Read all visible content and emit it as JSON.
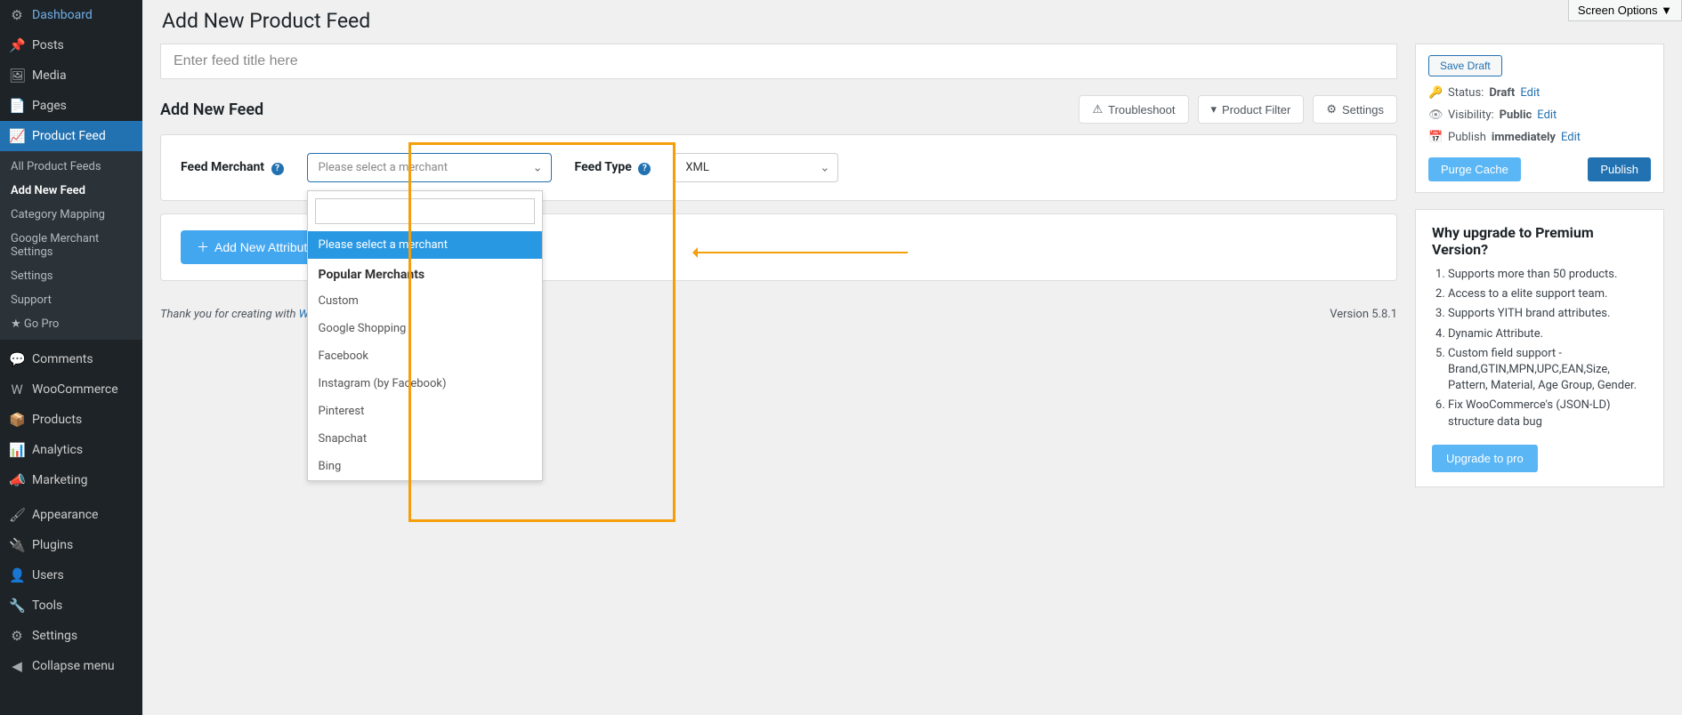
{
  "screenOptions": "Screen Options ▼",
  "pageTitle": "Add New Product Feed",
  "titlePlaceholder": "Enter feed title here",
  "sectionTitle": "Add New Feed",
  "toolbar": {
    "troubleshoot": "Troubleshoot",
    "productFilter": "Product Filter",
    "settings": "Settings"
  },
  "form": {
    "merchantLabel": "Feed Merchant",
    "merchantPlaceholder": "Please select a merchant",
    "feedTypeLabel": "Feed Type",
    "feedTypeValue": "XML"
  },
  "dropdown": {
    "selected": "Please select a merchant",
    "groupLabel": "Popular Merchants",
    "items": [
      "Custom",
      "Google Shopping",
      "Facebook",
      "Instagram (by Facebook)",
      "Pinterest",
      "Snapchat",
      "Bing"
    ]
  },
  "addAttr": "Add New Attribute",
  "sidebar": {
    "items": [
      {
        "icon": "⚙",
        "label": "Dashboard"
      },
      {
        "icon": "📌",
        "label": "Posts"
      },
      {
        "icon": "🖼",
        "label": "Media"
      },
      {
        "icon": "📄",
        "label": "Pages"
      },
      {
        "icon": "📈",
        "label": "Product Feed",
        "active": true
      },
      {
        "icon": "💬",
        "label": "Comments"
      },
      {
        "icon": "W",
        "label": "WooCommerce"
      },
      {
        "icon": "📦",
        "label": "Products"
      },
      {
        "icon": "📊",
        "label": "Analytics"
      },
      {
        "icon": "📣",
        "label": "Marketing"
      },
      {
        "icon": "🖌",
        "label": "Appearance"
      },
      {
        "icon": "🔌",
        "label": "Plugins"
      },
      {
        "icon": "👤",
        "label": "Users"
      },
      {
        "icon": "🔧",
        "label": "Tools"
      },
      {
        "icon": "⚙",
        "label": "Settings"
      },
      {
        "icon": "◀",
        "label": "Collapse menu"
      }
    ],
    "sub": [
      "All Product Feeds",
      "Add New Feed",
      "Category Mapping",
      "Google Merchant Settings",
      "Settings",
      "Support",
      "★ Go Pro"
    ],
    "subCurrent": "Add New Feed"
  },
  "publishBox": {
    "saveDraft": "Save Draft",
    "statusLabel": "Status:",
    "statusValue": "Draft",
    "visLabel": "Visibility:",
    "visValue": "Public",
    "pubLabel": "Publish",
    "pubValue": "immediately",
    "edit": "Edit",
    "purge": "Purge Cache",
    "publish": "Publish"
  },
  "upgrade": {
    "title": "Why upgrade to Premium Version?",
    "items": [
      "Supports more than 50 products.",
      "Access to a elite support team.",
      "Supports YITH brand attributes.",
      "Dynamic Attribute.",
      "Custom field support - Brand,GTIN,MPN,UPC,EAN,Size, Pattern, Material, Age Group, Gender.",
      "Fix WooCommerce's (JSON-LD) structure data bug"
    ],
    "button": "Upgrade to pro"
  },
  "footer": {
    "thanks": "Thank you for creating with ",
    "wp": "WordPress",
    "version": "Version 5.8.1"
  }
}
